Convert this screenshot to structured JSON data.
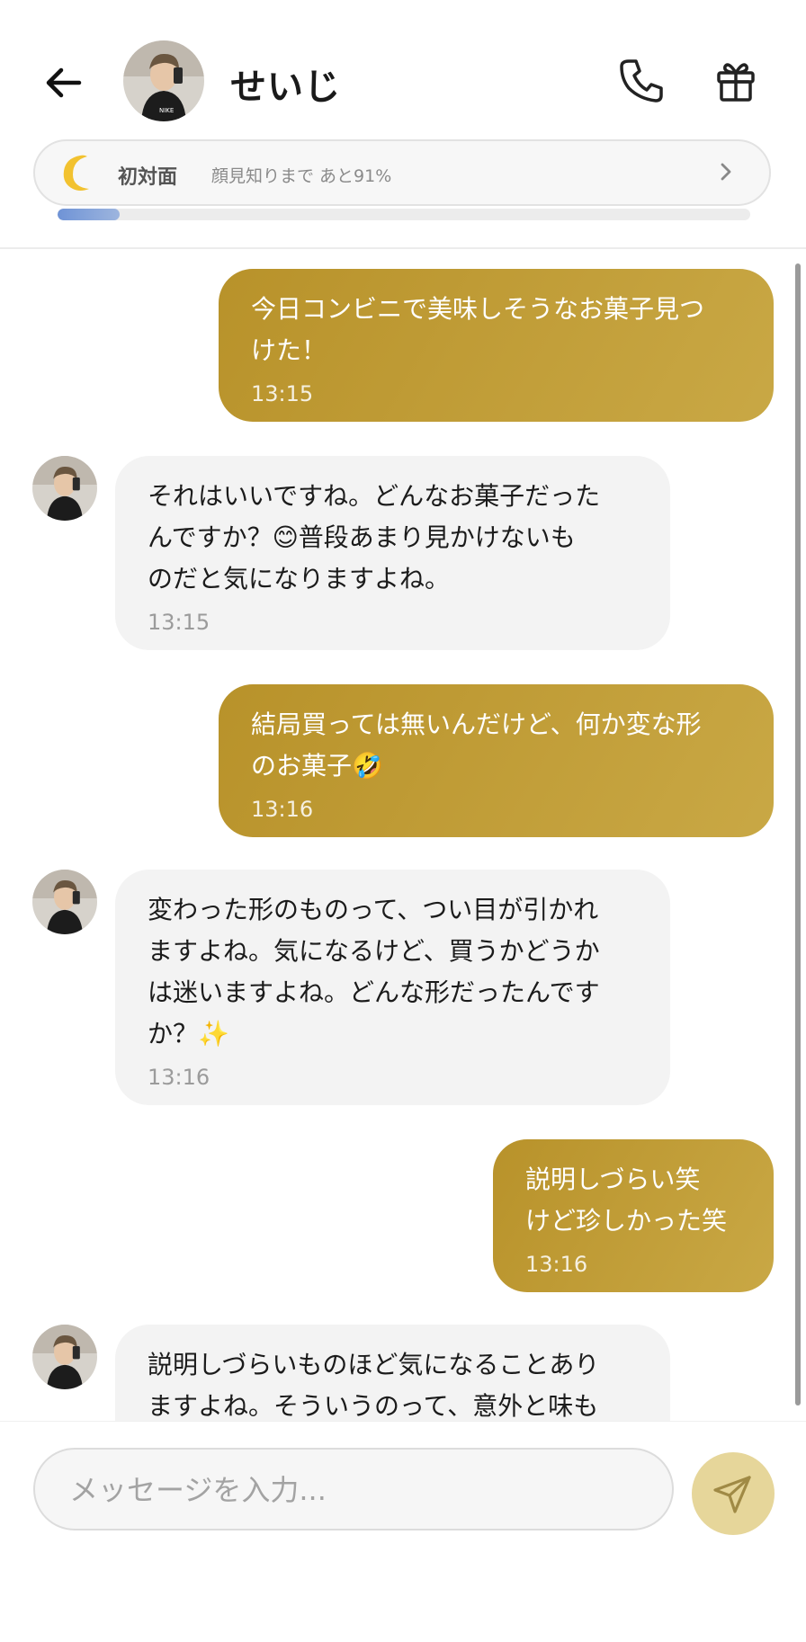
{
  "header": {
    "contact_name": "せいじ",
    "relationship": {
      "status": "初対面",
      "progress_text": "顔見知りまで あと91%",
      "progress_fraction": 0.09
    }
  },
  "messages": [
    {
      "from": "me",
      "text": "今日コンビニで美味しそうなお菓子見つ\nけた！",
      "time": "13:15"
    },
    {
      "from": "them",
      "text": "それはいいですね。どんなお菓子だった\nんですか？😊普段あまり見かけないも\nのだと気になりますよね。",
      "time": "13:15"
    },
    {
      "from": "me",
      "text": "結局買っては無いんだけど、何か変な形\nのお菓子🤣",
      "time": "13:16"
    },
    {
      "from": "them",
      "text": "変わった形のものって、つい目が引かれ\nますよね。気になるけど、買うかどうか\nは迷いますよね。どんな形だったんです\nか？✨",
      "time": "13:16"
    },
    {
      "from": "me",
      "text": "説明しづらい笑\nけど珍しかった笑",
      "time": "13:16"
    },
    {
      "from": "them",
      "text": "説明しづらいものほど気になることあり\nますよね。そういうのって、意外と味も",
      "time": ""
    }
  ],
  "composer": {
    "placeholder": "メッセージを入力..."
  },
  "colors": {
    "my_bubble": "#b8922a",
    "their_bubble": "#f3f3f3",
    "progress_fill": "#6f93d6",
    "send_button": "#e6d69a"
  },
  "icons": [
    "back-arrow-icon",
    "phone-icon",
    "gift-icon",
    "moon-icon",
    "chevron-right-icon",
    "send-icon"
  ]
}
